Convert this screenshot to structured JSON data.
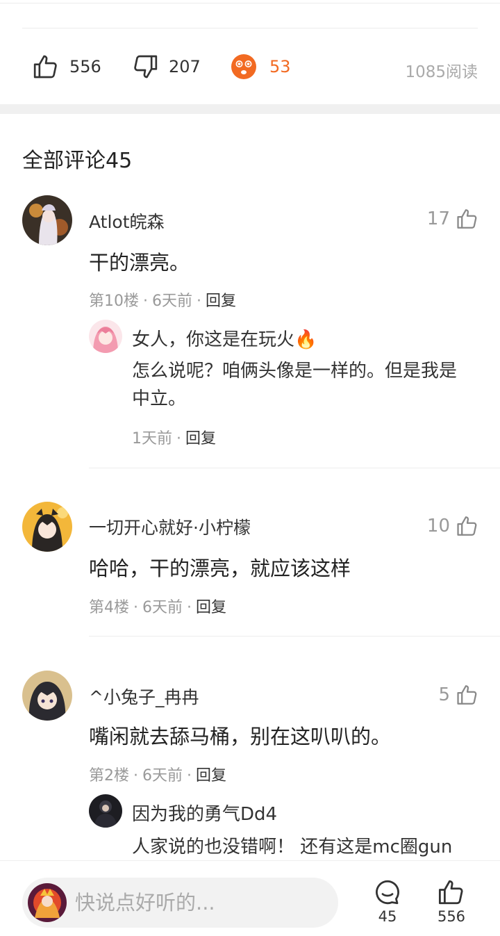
{
  "stats": {
    "likes": "556",
    "dislikes": "207",
    "reactions": "53",
    "reads": "1085阅读"
  },
  "section_title": "全部评论45",
  "comments": [
    {
      "name": "Atlot皖森",
      "likes": "17",
      "text": "干的漂亮。",
      "floor": "第10楼",
      "time": "6天前",
      "reply_label": "回复",
      "replies": [
        {
          "name": "女人，你这是在玩火🔥",
          "text": "怎么说呢？咱俩头像是一样的。但是我是中立。",
          "time": "1天前",
          "reply_label": "回复"
        }
      ]
    },
    {
      "name": "一切开心就好·小柠檬",
      "likes": "10",
      "text": "哈哈，干的漂亮，就应该这样",
      "floor": "第4楼",
      "time": "6天前",
      "reply_label": "回复"
    },
    {
      "name": "^小兔子_冉冉",
      "likes": "5",
      "text": "嘴闲就去舔马桶，别在这叭叭的。",
      "floor": "第2楼",
      "time": "6天前",
      "reply_label": "回复",
      "replies": [
        {
          "name": "因为我的勇气Dd4",
          "text": "人家说的也没错啊！ 还有这是mc圈gun"
        }
      ]
    }
  ],
  "bottom_bar": {
    "input_placeholder": "快说点好听的...",
    "comment_count": "45",
    "like_count": "556"
  },
  "colors": {
    "accent_orange": "#f26a22",
    "muted": "#999999"
  }
}
